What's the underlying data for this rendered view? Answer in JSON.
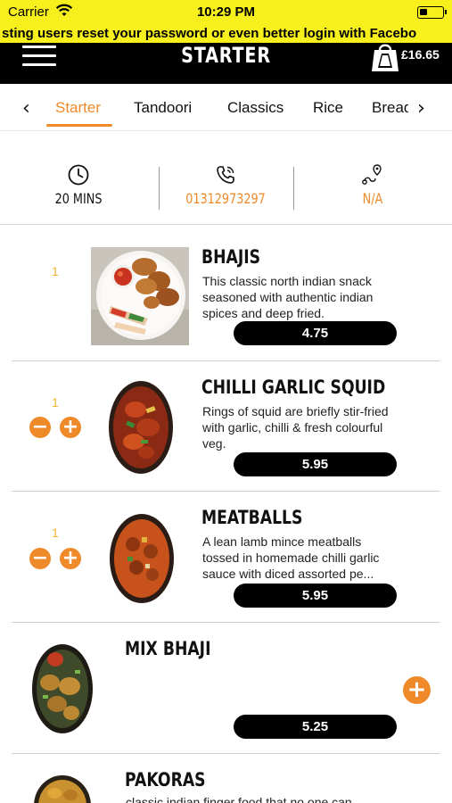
{
  "status_bar": {
    "carrier": "Carrier",
    "time": "10:29 PM"
  },
  "marquee": {
    "text": "sting users reset your password or even better login with Facebo"
  },
  "header": {
    "title": "STARTER",
    "cart_total": "£16.65"
  },
  "tabs": {
    "items": [
      "Starter",
      "Tandoori",
      "Classics",
      "Rice",
      "Bread"
    ],
    "active": "Starter"
  },
  "info": {
    "delivery_time": "20 MINS",
    "phone": "01312973297",
    "distance": "N/A"
  },
  "menu_items": [
    {
      "name": "BHAJIS",
      "description": "This classic north indian snack seasoned with authentic indian spices and deep fried.",
      "price": "4.75",
      "quantity": "1"
    },
    {
      "name": "CHILLI GARLIC SQUID",
      "description": "Rings of squid are briefly stir-fried with garlic, chilli & fresh colourful veg.",
      "price": "5.95",
      "quantity": "1"
    },
    {
      "name": "MEATBALLS",
      "description": "A lean lamb mince meatballs tossed in homemade chilli garlic sauce with diced assorted pe...",
      "price": "5.95",
      "quantity": "1"
    },
    {
      "name": "MIX BHAJI",
      "description": "",
      "price": "5.25",
      "quantity": ""
    },
    {
      "name": "PAKORAS",
      "description": "classic indian finger food that no one can",
      "price": "",
      "quantity": ""
    }
  ],
  "colors": {
    "accent": "#ef8a2a",
    "banner": "#f7f01c",
    "header": "#000000"
  },
  "icons": [
    "wifi-icon",
    "battery-icon",
    "hamburger-icon",
    "cart-icon",
    "clock-icon",
    "phone-icon",
    "location-icon",
    "chevron-left-icon",
    "chevron-right-icon",
    "minus-icon",
    "plus-icon"
  ]
}
